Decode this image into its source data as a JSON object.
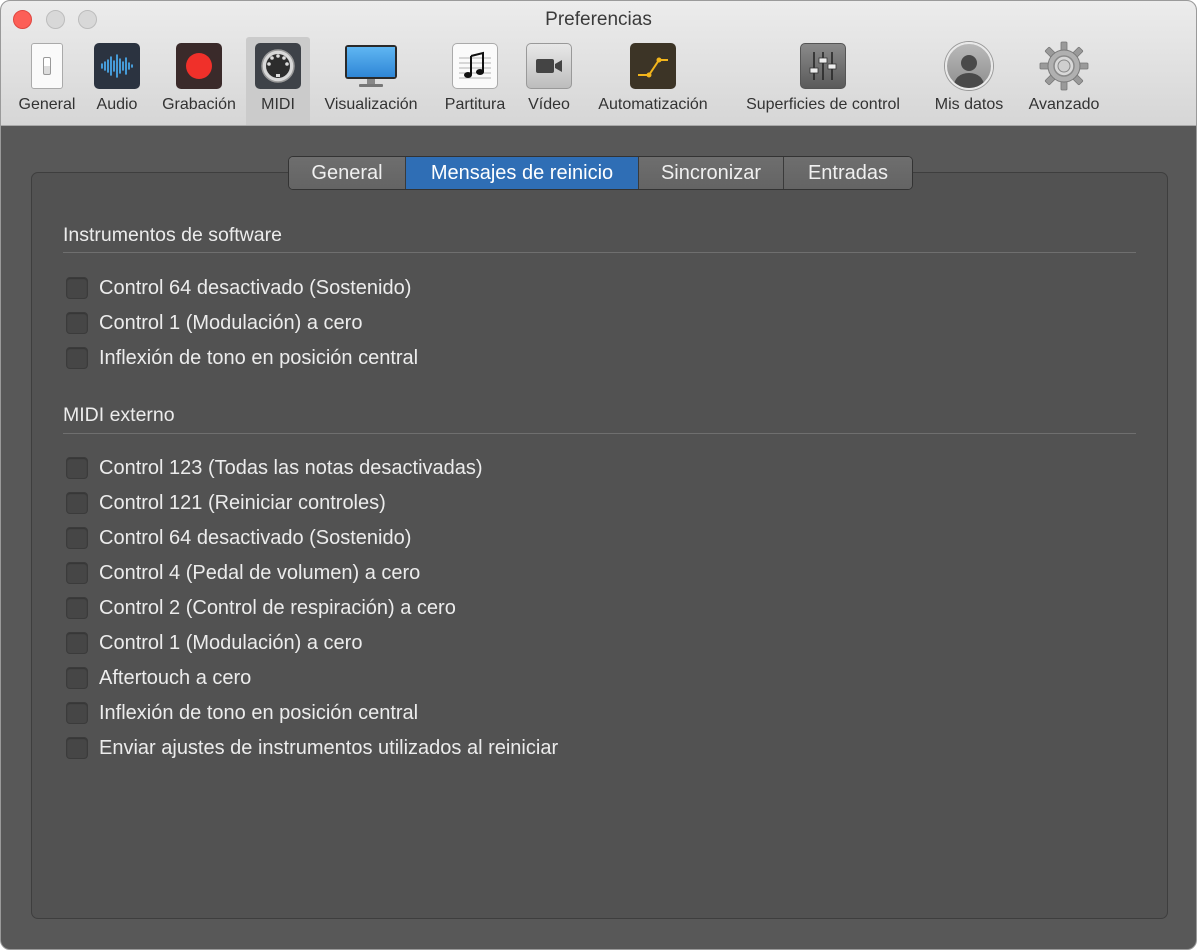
{
  "window": {
    "title": "Preferencias"
  },
  "toolbar": {
    "items": [
      {
        "label": "General",
        "icon": "general-switch-icon"
      },
      {
        "label": "Audio",
        "icon": "audio-waveform-icon"
      },
      {
        "label": "Grabación",
        "icon": "record-icon"
      },
      {
        "label": "MIDI",
        "icon": "midi-connector-icon",
        "selected": true
      },
      {
        "label": "Visualización",
        "icon": "display-monitor-icon"
      },
      {
        "label": "Partitura",
        "icon": "music-note-icon"
      },
      {
        "label": "Vídeo",
        "icon": "video-camera-icon"
      },
      {
        "label": "Automatización",
        "icon": "automation-curve-icon"
      },
      {
        "label": "Superficies de control",
        "icon": "control-faders-icon"
      },
      {
        "label": "Mis datos",
        "icon": "user-silhouette-icon"
      },
      {
        "label": "Avanzado",
        "icon": "gear-icon"
      }
    ]
  },
  "tabs": [
    {
      "label": "General",
      "active": false
    },
    {
      "label": "Mensajes de reinicio",
      "active": true
    },
    {
      "label": "Sincronizar",
      "active": false
    },
    {
      "label": "Entradas",
      "active": false
    }
  ],
  "software": {
    "title": "Instrumentos de software",
    "options": [
      {
        "label": "Control 64 desactivado (Sostenido)",
        "checked": false
      },
      {
        "label": "Control 1 (Modulación) a cero",
        "checked": false
      },
      {
        "label": "Inflexión de tono en posición central",
        "checked": false
      }
    ]
  },
  "external": {
    "title": "MIDI externo",
    "options": [
      {
        "label": "Control 123 (Todas las notas desactivadas)",
        "checked": false
      },
      {
        "label": "Control 121 (Reiniciar controles)",
        "checked": false
      },
      {
        "label": "Control 64 desactivado (Sostenido)",
        "checked": false
      },
      {
        "label": "Control 4 (Pedal de volumen) a cero",
        "checked": false
      },
      {
        "label": "Control 2 (Control de respiración) a cero",
        "checked": false
      },
      {
        "label": "Control 1 (Modulación) a cero",
        "checked": false
      },
      {
        "label": "Aftertouch a cero",
        "checked": false
      },
      {
        "label": "Inflexión de tono en posición central",
        "checked": false
      },
      {
        "label": "Enviar ajustes de instrumentos utilizados al reiniciar",
        "checked": false
      }
    ]
  },
  "colors": {
    "accent": "#2f6eb5",
    "record": "#f0302a",
    "close": "#fc5f57"
  }
}
